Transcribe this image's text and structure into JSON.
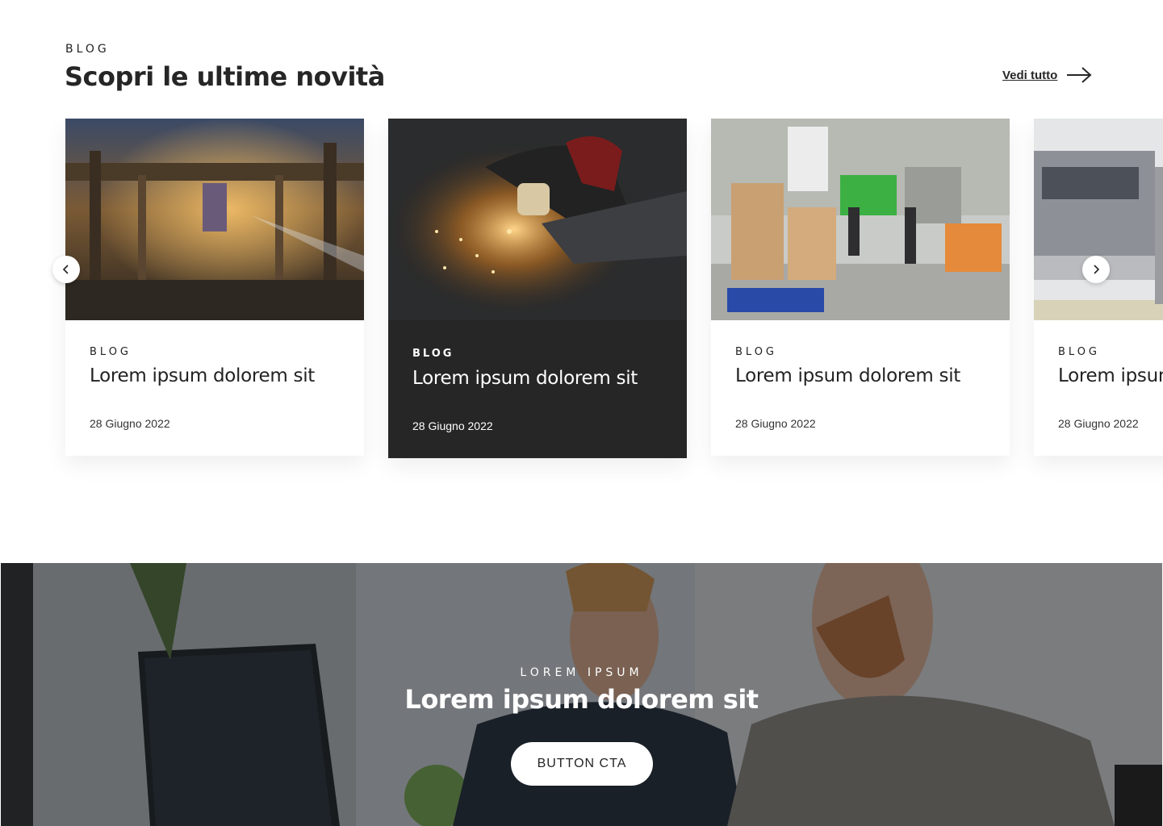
{
  "blog": {
    "eyebrow": "BLOG",
    "title": "Scopri le ultime novità",
    "see_all_label": "Vedi tutto",
    "cards": [
      {
        "eyebrow": "BLOG",
        "title": "Lorem ipsum dolorem sit",
        "date": "28 Giugno 2022"
      },
      {
        "eyebrow": "BLOG",
        "title": "Lorem ipsum dolorem sit",
        "date": "28 Giugno 2022"
      },
      {
        "eyebrow": "BLOG",
        "title": "Lorem ipsum dolorem sit",
        "date": "28 Giugno 2022"
      },
      {
        "eyebrow": "BLOG",
        "title": "Lorem ipsum dolorem sit",
        "date": "28 Giugno 2022"
      }
    ]
  },
  "cta": {
    "eyebrow": "LOREM IPSUM",
    "title": "Lorem ipsum dolorem sit",
    "button_label": "BUTTON CTA"
  },
  "colors": {
    "text_dark": "#262626",
    "card_dark_bg": "#262626",
    "white": "#ffffff"
  },
  "icons": {
    "see_all": "arrow-right-icon",
    "prev": "chevron-left-icon",
    "next": "chevron-right-icon"
  }
}
